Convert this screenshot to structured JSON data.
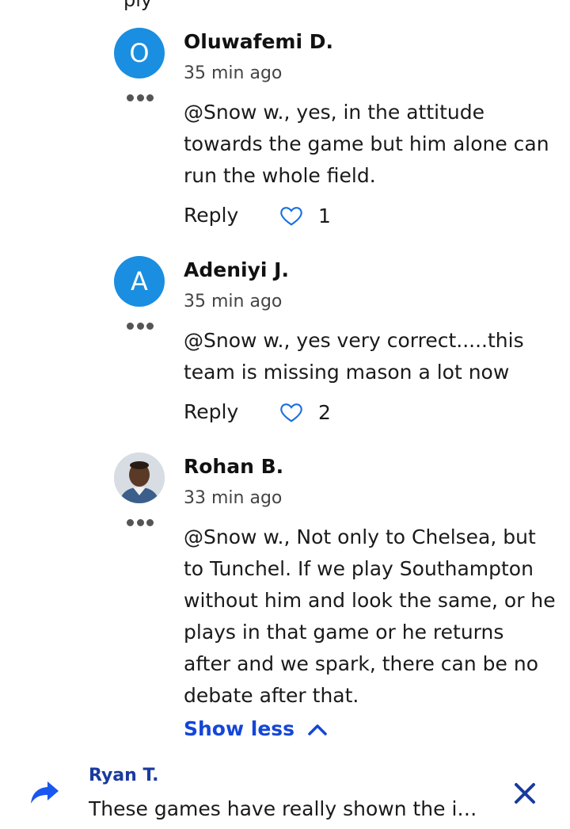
{
  "top_fragment": "ply",
  "comments": [
    {
      "initial": "O",
      "name": "Oluwafemi D.",
      "time": "35 min ago",
      "text": "@Snow w., yes, in the attitude towards the game but him alone can run the whole field.",
      "reply_label": "Reply",
      "likes": "1",
      "avatar_color": "#1a8ee0"
    },
    {
      "initial": "A",
      "name": "Adeniyi J.",
      "time": "35 min ago",
      "text": "@Snow w., yes very correct.....this team is missing mason a lot now",
      "reply_label": "Reply",
      "likes": "2",
      "avatar_color": "#1a8ee0"
    },
    {
      "initial": "",
      "name": "Rohan B.",
      "time": "33 min ago",
      "text": "@Snow w., Not only to Chelsea, but to Tunchel. If we play Southampton without him and look the same, or he plays in that game or  he returns after and we spark, there can be no debate after that."
    }
  ],
  "show_less_label": "Show less",
  "bottom_bar": {
    "name": "Ryan T.",
    "text": "These games have really shown the i…"
  },
  "colors": {
    "accent": "#1446d8",
    "heart": "#1a6fe0",
    "bottom_name": "#1a3a9e"
  }
}
